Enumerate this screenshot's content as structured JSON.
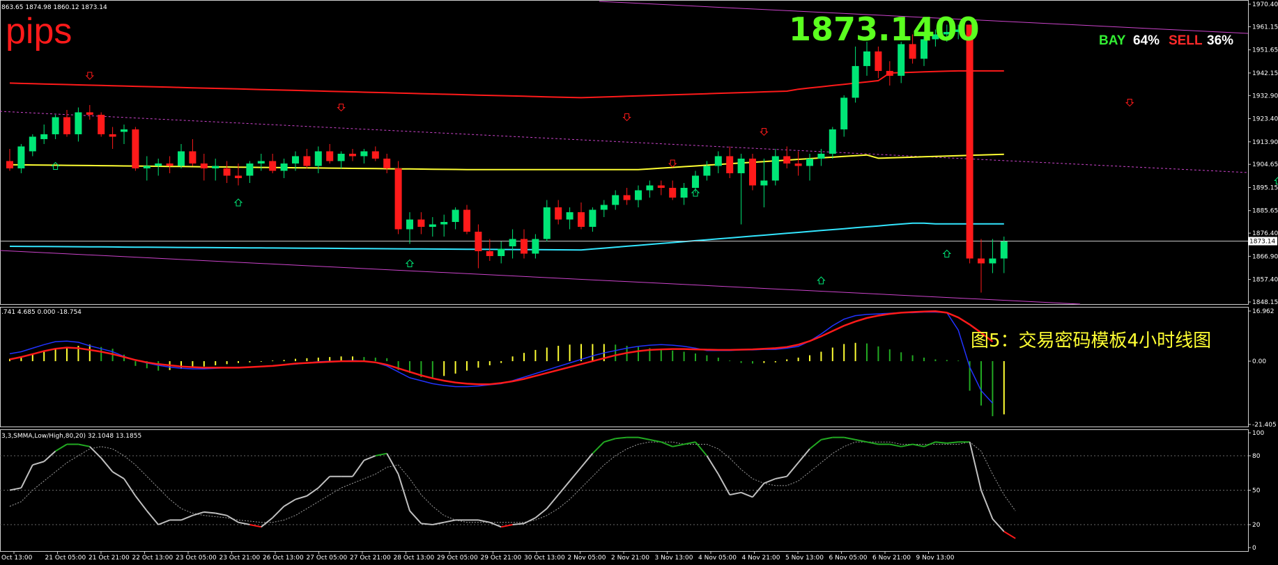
{
  "overlay": {
    "pips_label": "pips",
    "big_price": "1873.1400",
    "buy_label": "BAY",
    "buy_pct": "64%",
    "sell_label": "SELL",
    "sell_pct": "36%",
    "caption": "图5：交易密码模板4小时线图"
  },
  "panels": {
    "main": {
      "info": "863.65 1874.98 1860.12 1873.14",
      "price_ticks": [
        "1970.40",
        "1961.15",
        "1951.65",
        "1942.15",
        "1932.90",
        "1923.40",
        "1913.90",
        "1904.65",
        "1895.15",
        "1885.65",
        "1876.40",
        "1866.90",
        "1857.40",
        "1848.15"
      ],
      "current_price": "1873.14"
    },
    "macd": {
      "info": ".741 4.685 0.000 -18.754",
      "ticks": [
        "16.962",
        "0.00",
        "-21.405"
      ]
    },
    "stoch": {
      "info": "3,3,SMMA,Low/High,80,20) 32.1048 13.1855",
      "ticks": [
        "100",
        "80",
        "50",
        "20",
        "0"
      ]
    }
  },
  "time_axis": [
    "Oct 13:00",
    "21 Oct 05:00",
    "21 Oct 21:00",
    "22 Oct 13:00",
    "23 Oct 05:00",
    "23 Oct 21:00",
    "26 Oct 13:00",
    "27 Oct 05:00",
    "27 Oct 21:00",
    "28 Oct 13:00",
    "29 Oct 05:00",
    "29 Oct 21:00",
    "30 Oct 13:00",
    "2 Nov 05:00",
    "2 Nov 21:00",
    "3 Nov 13:00",
    "4 Nov 05:00",
    "4 Nov 21:00",
    "5 Nov 13:00",
    "6 Nov 05:00",
    "6 Nov 21:00",
    "9 Nov 13:00"
  ],
  "colors": {
    "background": "#000000",
    "bull": "#00e676",
    "bear": "#ff1a1a",
    "upper_band": "#ff1a1a",
    "mid_ma": "#ffff33",
    "lower_band": "#33e6ff",
    "channel": "#cc44cc",
    "macd_signal": "#ff1a1a",
    "macd_line": "#2233ff",
    "stoch_main": "#c0c0c0",
    "stoch_overbought": "#22aa22",
    "stoch_oversold": "#ff1a1a"
  },
  "chart_data": [
    {
      "type": "candlestick",
      "title": "",
      "ylim": [
        1848.15,
        1970.4
      ],
      "candles": [
        [
          1906,
          1911,
          1902,
          1903
        ],
        [
          1903,
          1913,
          1901,
          1912
        ],
        [
          1910,
          1917,
          1908,
          1916
        ],
        [
          1915,
          1921,
          1913,
          1917
        ],
        [
          1917,
          1925,
          1915,
          1924
        ],
        [
          1924,
          1927,
          1916,
          1917
        ],
        [
          1917,
          1928,
          1914,
          1926
        ],
        [
          1926,
          1929,
          1923,
          1925
        ],
        [
          1925,
          1926,
          1916,
          1917
        ],
        [
          1917,
          1920,
          1911,
          1916
        ],
        [
          1918,
          1921,
          1913,
          1919
        ],
        [
          1919,
          1920,
          1902,
          1903
        ],
        [
          1903,
          1908,
          1898,
          1904
        ],
        [
          1904,
          1907,
          1900,
          1905
        ],
        [
          1905,
          1908,
          1901,
          1904
        ],
        [
          1904,
          1913,
          1903,
          1910
        ],
        [
          1910,
          1915,
          1904,
          1905
        ],
        [
          1905,
          1909,
          1898,
          1903
        ],
        [
          1903,
          1907,
          1898,
          1904
        ],
        [
          1903,
          1906,
          1897,
          1900
        ],
        [
          1900,
          1905,
          1896,
          1899
        ],
        [
          1900,
          1906,
          1897,
          1905
        ],
        [
          1905,
          1909,
          1902,
          1906
        ],
        [
          1906,
          1909,
          1901,
          1902
        ],
        [
          1902,
          1907,
          1899,
          1905
        ],
        [
          1905,
          1910,
          1902,
          1908
        ],
        [
          1908,
          1911,
          1903,
          1904
        ],
        [
          1904,
          1912,
          1901,
          1910
        ],
        [
          1910,
          1913,
          1905,
          1906
        ],
        [
          1906,
          1910,
          1903,
          1909
        ],
        [
          1909,
          1911,
          1906,
          1908
        ],
        [
          1908,
          1911,
          1905,
          1910
        ],
        [
          1910,
          1912,
          1906,
          1907
        ],
        [
          1907,
          1909,
          1901,
          1903
        ],
        [
          1903,
          1906,
          1876,
          1878
        ],
        [
          1878,
          1885,
          1872,
          1882
        ],
        [
          1882,
          1885,
          1876,
          1879
        ],
        [
          1879,
          1883,
          1875,
          1880
        ],
        [
          1880,
          1884,
          1875,
          1881
        ],
        [
          1881,
          1887,
          1878,
          1886
        ],
        [
          1886,
          1888,
          1876,
          1877
        ],
        [
          1877,
          1880,
          1862,
          1869
        ],
        [
          1869,
          1874,
          1865,
          1867
        ],
        [
          1867,
          1873,
          1864,
          1870
        ],
        [
          1871,
          1878,
          1866,
          1874
        ],
        [
          1874,
          1878,
          1866,
          1868
        ],
        [
          1868,
          1876,
          1866,
          1874
        ],
        [
          1874,
          1890,
          1873,
          1887
        ],
        [
          1887,
          1890,
          1880,
          1882
        ],
        [
          1882,
          1887,
          1878,
          1885
        ],
        [
          1885,
          1889,
          1878,
          1879
        ],
        [
          1879,
          1887,
          1877,
          1886
        ],
        [
          1886,
          1890,
          1883,
          1888
        ],
        [
          1888,
          1894,
          1886,
          1892
        ],
        [
          1892,
          1895,
          1888,
          1890
        ],
        [
          1890,
          1896,
          1887,
          1894
        ],
        [
          1894,
          1898,
          1891,
          1896
        ],
        [
          1896,
          1898,
          1892,
          1895
        ],
        [
          1895,
          1898,
          1890,
          1891
        ],
        [
          1891,
          1897,
          1888,
          1895
        ],
        [
          1895,
          1902,
          1893,
          1900
        ],
        [
          1900,
          1906,
          1898,
          1904
        ],
        [
          1904,
          1910,
          1901,
          1908
        ],
        [
          1908,
          1912,
          1899,
          1901
        ],
        [
          1901,
          1909,
          1880,
          1907
        ],
        [
          1907,
          1909,
          1894,
          1896
        ],
        [
          1896,
          1907,
          1887,
          1898
        ],
        [
          1898,
          1911,
          1896,
          1908
        ],
        [
          1908,
          1912,
          1903,
          1905
        ],
        [
          1905,
          1910,
          1900,
          1904
        ],
        [
          1904,
          1909,
          1898,
          1907
        ],
        [
          1907,
          1911,
          1904,
          1909
        ],
        [
          1909,
          1920,
          1907,
          1919
        ],
        [
          1919,
          1933,
          1916,
          1932
        ],
        [
          1932,
          1953,
          1930,
          1945
        ],
        [
          1945,
          1955,
          1941,
          1951
        ],
        [
          1951,
          1953,
          1940,
          1943
        ],
        [
          1943,
          1947,
          1937,
          1941
        ],
        [
          1941,
          1955,
          1938,
          1954
        ],
        [
          1954,
          1958,
          1946,
          1948
        ],
        [
          1948,
          1958,
          1945,
          1956
        ],
        [
          1956,
          1960,
          1953,
          1958
        ],
        [
          1958,
          1962,
          1955,
          1959
        ],
        [
          1959,
          1962,
          1956,
          1960
        ],
        [
          1962,
          1962,
          1864,
          1866
        ],
        [
          1866,
          1874,
          1852,
          1864
        ],
        [
          1864,
          1874,
          1860,
          1866
        ],
        [
          1866,
          1875,
          1860,
          1873
        ]
      ]
    },
    {
      "type": "bar",
      "title": "",
      "ylim": [
        -21.405,
        16.962
      ],
      "values": [
        0.8,
        1.6,
        2.4,
        3.2,
        4,
        4.6,
        5.2,
        5.6,
        4.8,
        4.2,
        2.2,
        -1.6,
        -2.4,
        -3.2,
        -3,
        -2.6,
        -2,
        -1.8,
        -1.4,
        -1,
        -0.6,
        -0.4,
        -0.2,
        0.2,
        0.4,
        0.8,
        1,
        1.2,
        1.4,
        1.6,
        1.6,
        1.4,
        1.2,
        1,
        -3,
        -4,
        -5.4,
        -5.6,
        -5,
        -4.2,
        -3.2,
        -2.2,
        -1.4,
        -0.6,
        1.6,
        2.8,
        3.8,
        4.6,
        5.2,
        5.6,
        5.8,
        5.8,
        5.8,
        5.6,
        5.2,
        4.8,
        4.4,
        4,
        3.6,
        3.2,
        2.6,
        2,
        1.2,
        0.2,
        -0.6,
        -0.8,
        -0.6,
        -0.4,
        0.6,
        1.2,
        2,
        3.2,
        4.6,
        5.8,
        6.2,
        6,
        5,
        4,
        3,
        2,
        1.2,
        0.6,
        0.4,
        0.2,
        -10,
        -15,
        -18.6,
        -18
      ],
      "series": [
        {
          "values": [
            2.5,
            3.2,
            4.4,
            5.6,
            6.6,
            6.8,
            6.4,
            5.2,
            4.2,
            3.2,
            1.6,
            0.4,
            -0.6,
            -1.4,
            -2,
            -2.4,
            -2.6,
            -2.6,
            -2.4,
            -2.2,
            -2.1,
            -2,
            -1.8,
            -1.6,
            -1.2,
            -1,
            -0.6,
            -0.2,
            0,
            0,
            0.2,
            0,
            -0.4,
            -1.6,
            -3.6,
            -5.6,
            -6.6,
            -7.6,
            -8.2,
            -8.6,
            -8.6,
            -8.4,
            -8,
            -7.6,
            -6.6,
            -5.4,
            -4.2,
            -3,
            -1.8,
            -0.6,
            0.6,
            1.8,
            2.8,
            3.6,
            4.4,
            5,
            5.4,
            5.6,
            5.4,
            5,
            4.4,
            3.6,
            3.6,
            3.6,
            3.8,
            3.8,
            4,
            4,
            4.4,
            5,
            6.8,
            9.2,
            12,
            14.2,
            15.4,
            15.8,
            16,
            16.2,
            16.4,
            16.4,
            16.6,
            16.6,
            16.4,
            10.5,
            -2,
            -10,
            -14.2
          ]
        },
        {
          "values": [
            0.6,
            1.4,
            2.4,
            3.4,
            4.2,
            4.6,
            4.4,
            3.8,
            3.2,
            2.4,
            1.4,
            0.4,
            -0.4,
            -1,
            -1.4,
            -1.8,
            -2,
            -2.2,
            -2.2,
            -2.2,
            -2.2,
            -2,
            -1.8,
            -1.6,
            -1.2,
            -0.8,
            -0.6,
            -0.4,
            -0.2,
            0,
            0,
            0,
            -0.4,
            -1.2,
            -2.4,
            -3.6,
            -4.8,
            -5.8,
            -6.6,
            -7.2,
            -7.6,
            -7.8,
            -7.8,
            -7.4,
            -6.8,
            -6,
            -5,
            -4,
            -3,
            -2,
            -1,
            0,
            1,
            2,
            2.8,
            3.4,
            3.8,
            4,
            4.1,
            4.1,
            4,
            3.9,
            3.8,
            3.8,
            3.9,
            4,
            4.2,
            4.4,
            4.8,
            5.6,
            6.8,
            8.4,
            10.2,
            12,
            13.4,
            14.6,
            15.4,
            16,
            16.4,
            16.6,
            16.8,
            16.9,
            16.4,
            14.8,
            12.4,
            9.6,
            6.6
          ]
        }
      ]
    },
    {
      "type": "line",
      "title": "",
      "ylim": [
        0,
        100
      ],
      "series": [
        {
          "values": [
            50,
            52,
            72,
            75,
            84,
            90,
            90,
            88,
            78,
            66,
            60,
            45,
            32,
            20,
            24,
            24,
            28,
            31,
            30,
            28,
            22,
            20,
            18,
            26,
            36,
            42,
            45,
            52,
            62,
            62,
            62,
            76,
            80,
            82,
            64,
            32,
            21,
            20,
            22,
            24,
            24,
            24,
            22,
            18,
            20,
            21,
            26,
            34,
            46,
            58,
            70,
            82,
            92,
            95,
            96,
            96,
            94,
            92,
            88,
            90,
            92,
            80,
            64,
            46,
            48,
            44,
            56,
            60,
            62,
            74,
            86,
            94,
            96,
            96,
            94,
            92,
            90,
            90,
            88,
            90,
            88,
            92,
            91,
            92,
            92,
            50,
            25,
            14,
            8
          ]
        },
        {
          "values": [
            36,
            40,
            50,
            58,
            66,
            74,
            80,
            86,
            88,
            86,
            80,
            72,
            62,
            52,
            42,
            34,
            30,
            28,
            27,
            26,
            24,
            23,
            22,
            22,
            24,
            28,
            34,
            40,
            46,
            52,
            56,
            60,
            64,
            70,
            72,
            60,
            46,
            36,
            28,
            24,
            22,
            22,
            22,
            22,
            22,
            22,
            24,
            28,
            34,
            42,
            52,
            62,
            72,
            80,
            86,
            90,
            92,
            92,
            92,
            90,
            90,
            90,
            86,
            78,
            68,
            60,
            56,
            54,
            54,
            58,
            66,
            74,
            82,
            88,
            92,
            92,
            92,
            92,
            90,
            90,
            90,
            90,
            90,
            90,
            92,
            84,
            64,
            46,
            32
          ]
        }
      ]
    }
  ]
}
